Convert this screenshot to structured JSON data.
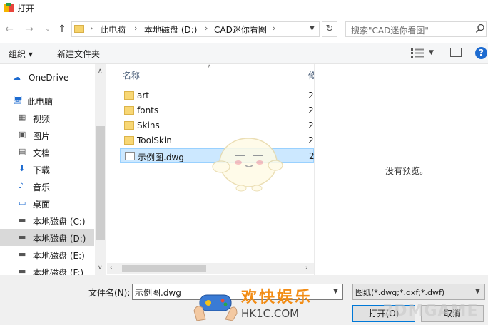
{
  "window": {
    "title": "打开"
  },
  "address": {
    "crumbs": [
      "此电脑",
      "本地磁盘 (D:)",
      "CAD迷你看图"
    ],
    "search_placeholder": "搜索\"CAD迷你看图\""
  },
  "toolbar": {
    "organize": "组织 ▾",
    "new_folder": "新建文件夹",
    "help": "?"
  },
  "nav": {
    "items": [
      {
        "label": "OneDrive",
        "icon": "cloud-icon"
      },
      {
        "label": "此电脑",
        "icon": "computer-icon"
      },
      {
        "label": "视频",
        "icon": "video-icon"
      },
      {
        "label": "图片",
        "icon": "picture-icon"
      },
      {
        "label": "文档",
        "icon": "document-icon"
      },
      {
        "label": "下载",
        "icon": "download-icon"
      },
      {
        "label": "音乐",
        "icon": "music-icon"
      },
      {
        "label": "桌面",
        "icon": "desktop-icon"
      },
      {
        "label": "本地磁盘 (C:)",
        "icon": "drive-icon"
      },
      {
        "label": "本地磁盘 (D:)",
        "icon": "drive-icon",
        "selected": true
      },
      {
        "label": "本地磁盘 (E:)",
        "icon": "drive-icon"
      },
      {
        "label": "本地磁盘 (F:)",
        "icon": "drive-icon"
      }
    ]
  },
  "files": {
    "columns": {
      "name": "名称",
      "date": "修"
    },
    "rows": [
      {
        "name": "art",
        "date": "2",
        "type": "folder"
      },
      {
        "name": "fonts",
        "date": "2",
        "type": "folder"
      },
      {
        "name": "Skins",
        "date": "2",
        "type": "folder"
      },
      {
        "name": "ToolSkin",
        "date": "2",
        "type": "folder"
      },
      {
        "name": "示例图.dwg",
        "date": "2",
        "type": "dwg",
        "selected": true
      }
    ]
  },
  "preview": {
    "empty_text": "没有预览。"
  },
  "bottom": {
    "filename_label": "文件名(N):",
    "filename_value": "示例图.dwg",
    "filetype_value": "图纸(*.dwg;*.dxf;*.dwf)",
    "open_label": "打开(O)",
    "cancel_label": "取消"
  },
  "watermark": {
    "text1": "欢快娱乐",
    "text2": "HK1C.COM",
    "text3": "3DMGAME"
  },
  "colors": {
    "selection": "#cce8ff",
    "accent": "#0078d7",
    "folder": "#f8d775"
  }
}
